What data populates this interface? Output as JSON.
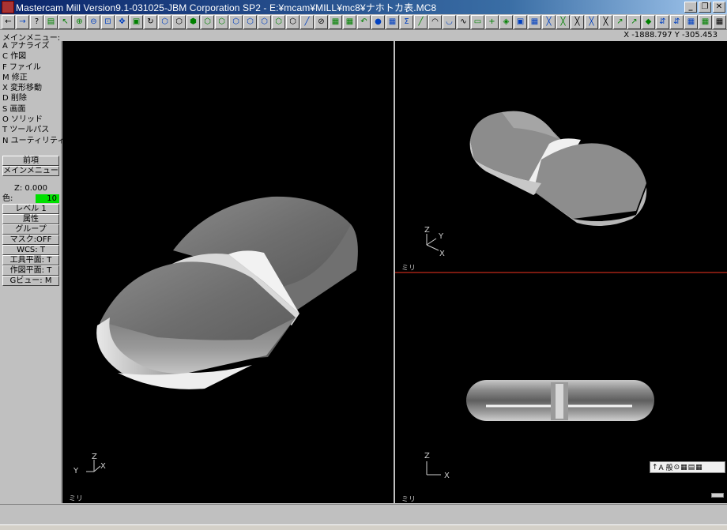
{
  "window": {
    "title": "Mastercam Mill Version9.1-031025-JBM Corporation SP2 - E:¥mcam¥MILL¥mc8¥ナホトカ表.MC8",
    "minimize_label": "_",
    "restore_label": "❐",
    "close_label": "✕"
  },
  "toolbar": {
    "icons": [
      "←",
      "→",
      "?",
      "▤",
      "↖",
      "⊕",
      "⊖",
      "⊡",
      "✥",
      "▣",
      "↻",
      "⬡",
      "⬡",
      "⬢",
      "⬡",
      "⬡",
      "⬡",
      "⬡",
      "⬡",
      "⬡",
      "⬡",
      "╱",
      "⊘",
      "▦",
      "▦",
      "↶",
      "●",
      "▦",
      "Σ",
      "╱",
      "◠",
      "◡",
      "∿",
      "▭",
      "+",
      "◈",
      "▣",
      "▦",
      "╳",
      "╳",
      "╳",
      "╳",
      "╳",
      "↗",
      "↗",
      "◆",
      "⇵",
      "⇵",
      "▦",
      "▦",
      "▦",
      "⊢",
      "▦",
      "▦"
    ]
  },
  "status": {
    "menu_title": "メインメニュー:",
    "coords": "X -1888.797   Y -305.453"
  },
  "leftmenu": {
    "items": [
      "A アナライズ",
      "C 作図",
      "F ファイル",
      "M 修正",
      "X 変形移動",
      "D 削除",
      "S 画面",
      "O ソリッド",
      "T ツールパス",
      "N ユーティリティ"
    ],
    "back_button": "前項",
    "main_menu_button": "メインメニュー",
    "z_label": "Z:   0.000",
    "color_label": "色:",
    "color_value": "10",
    "level_label": "レベル  1",
    "attr_label": "属性",
    "group_label": "グループ",
    "mask_label": "マスク:OFF",
    "wcs_label": "WCS:  T",
    "tool_plane_label": "工具平面:  T",
    "cplane_label": "作図平面:  T",
    "gview_label": "Gビュー:  M"
  },
  "viewports": {
    "left": {
      "unit_label": "ミリ",
      "axes": [
        "Z",
        "Y",
        "X"
      ]
    },
    "top_right": {
      "unit_label": "ミリ",
      "axes": [
        "Z",
        "Y",
        "X"
      ]
    },
    "bottom_right": {
      "unit_label": "ミリ",
      "axes": [
        "Z",
        "X"
      ]
    }
  },
  "mini_toolbar": {
    "label": "A 般",
    "icons": [
      "↑",
      "⊙",
      "▦",
      "▤",
      "▦"
    ]
  },
  "colors": {
    "title_bar": "#0a246a",
    "viewport_bg": "#000000",
    "color_indicator": "#00e000",
    "viewport_divider": "#7a1a10"
  }
}
